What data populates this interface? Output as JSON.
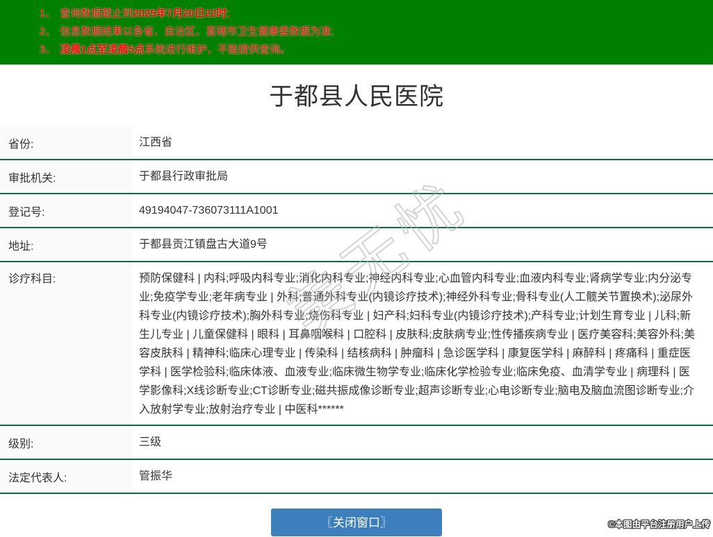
{
  "banner": {
    "bg_color": "#008000",
    "text_color": "#ff0000",
    "items": [
      {
        "num": "1、",
        "pre": "查询数据截止到",
        "bold": "2025年7月20日22时",
        "post": ";"
      },
      {
        "num": "2、",
        "pre": "信息数据结果以各省、自治区、直辖市卫生健康委数据为准;",
        "bold": "",
        "post": ""
      },
      {
        "num": "3、",
        "pre": "",
        "bold": "凌晨1点至凌晨5点",
        "post": "系统进行维护，不能提供查询。"
      }
    ]
  },
  "title": "于都县人民医院",
  "table": {
    "divider_color": "#066e3f",
    "rows": [
      {
        "label": "省份:",
        "value": "江西省"
      },
      {
        "label": "审批机关:",
        "value": "于都县行政审批局"
      },
      {
        "label": "登记号:",
        "value": "49194047-736073111A1001"
      },
      {
        "label": "地址:",
        "value": "于都县贡江镇盘古大道9号"
      },
      {
        "label": "诊疗科目:",
        "value": "预防保健科 | 内科;呼吸内科专业;消化内科专业;神经内科专业;心血管内科专业;血液内科专业;肾病学专业;内分泌专业;免疫学专业;老年病专业 | 外科;普通外科专业(内镜诊疗技术);神经外科专业;骨科专业(人工髋关节置换术);泌尿外科专业(内镜诊疗技术);胸外科专业;烧伤科专业 | 妇产科;妇科专业(内镜诊疗技术);产科专业;计划生育专业 | 儿科;新生儿专业 | 儿童保健科 | 眼科 | 耳鼻咽喉科 | 口腔科 | 皮肤科;皮肤病专业;性传播疾病专业 | 医疗美容科;美容外科;美容皮肤科 | 精神科;临床心理专业 | 传染科 | 结核病科 | 肿瘤科 | 急诊医学科 | 康复医学科 | 麻醉科 | 疼痛科 | 重症医学科 | 医学检验科;临床体液、血液专业;临床微生物学专业;临床化学检验专业;临床免疫、血清学专业 | 病理科 | 医学影像科;X线诊断专业;CT诊断专业;磁共振成像诊断专业;超声诊断专业;心电诊断专业;脑电及脑血流图诊断专业;介入放射学专业;放射治疗专业 | 中医科******"
      },
      {
        "label": "级别:",
        "value": "三级"
      },
      {
        "label": "法定代表人:",
        "value": "管振华"
      }
    ]
  },
  "close_button": {
    "label": "〖关闭窗口〗",
    "bg_color": "#3d7ebc"
  },
  "watermark": {
    "text": "美无忧"
  },
  "footer_note": "©本图由平台注册用户上传"
}
